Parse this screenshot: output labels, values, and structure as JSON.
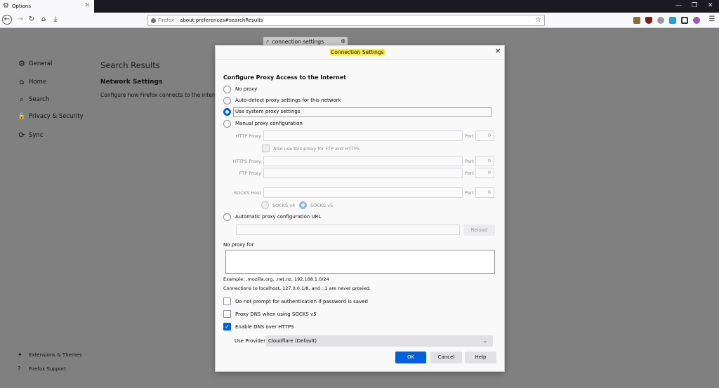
{
  "browser": {
    "tab_title": "Options",
    "new_tab_symbol": "+",
    "url_brand": "Firefox",
    "url": "about:preferences#searchResults",
    "window_controls": [
      "—",
      "❐",
      "✕"
    ],
    "nav_icons": [
      "back-icon",
      "forward-icon",
      "reload-icon",
      "home-icon",
      "downloads-icon"
    ],
    "ext_icons": [
      "extension-1-icon",
      "ublock-icon",
      "extension-3-icon",
      "extension-4-icon",
      "qr-icon",
      "extension-6-icon",
      "menu-icon"
    ]
  },
  "prefs": {
    "search_value": "connection settings",
    "sidebar": [
      {
        "label": "General",
        "icon": "gear-icon",
        "glyph": "⚙"
      },
      {
        "label": "Home",
        "icon": "home-icon",
        "glyph": "⌂"
      },
      {
        "label": "Search",
        "icon": "search-icon",
        "glyph": "⌕"
      },
      {
        "label": "Privacy & Security",
        "icon": "lock-icon",
        "glyph": "🔒"
      },
      {
        "label": "Sync",
        "icon": "sync-icon",
        "glyph": "⟳"
      }
    ],
    "footer": [
      {
        "label": "Extensions & Themes",
        "icon": "puzzle-icon",
        "glyph": "✦"
      },
      {
        "label": "Firefox Support",
        "icon": "help-icon",
        "glyph": "?"
      }
    ],
    "results_title": "Search Results",
    "section_title": "Network Settings",
    "section_desc": "Configure how Firefox connects to the internet"
  },
  "dialog": {
    "title": "Connection Settings",
    "heading": "Configure Proxy Access to the Internet",
    "options": {
      "no_proxy": "No proxy",
      "auto_detect": "Auto-detect proxy settings for this network",
      "system": "Use system proxy settings",
      "manual": "Manual proxy configuration",
      "auto_url": "Automatic proxy configuration URL"
    },
    "selected_option": "system",
    "http_proxy_label": "HTTP Proxy",
    "https_proxy_label": "HTTPS Proxy",
    "ftp_proxy_label": "FTP Proxy",
    "socks_host_label": "SOCKS Host",
    "port_label": "Port",
    "port_value": "0",
    "also_use_label": "Also use this proxy for FTP and HTTPS",
    "socks_v4": "SOCKS v4",
    "socks_v5": "SOCKS v5",
    "reload_label": "Reload",
    "no_proxy_for_label": "No proxy for",
    "example_text": "Example: .mozilla.org, .net.nz, 192.168.1.0/24",
    "localhost_text": "Connections to localhost, 127.0.0.1/8, and ::1 are never proxied.",
    "checkboxes": {
      "no_auth_prompt": "Do not prompt for authentication if password is saved",
      "proxy_dns": "Proxy DNS when using SOCKS v5",
      "dns_https": "Enable DNS over HTTPS"
    },
    "use_provider_label": "Use Provider",
    "provider_value": "Cloudflare (Default)",
    "ok_label": "OK",
    "cancel_label": "Cancel",
    "help_label": "Help"
  },
  "colors": {
    "accent": "#0060df",
    "highlight": "#ffeb3b",
    "overlay": "#808080"
  }
}
